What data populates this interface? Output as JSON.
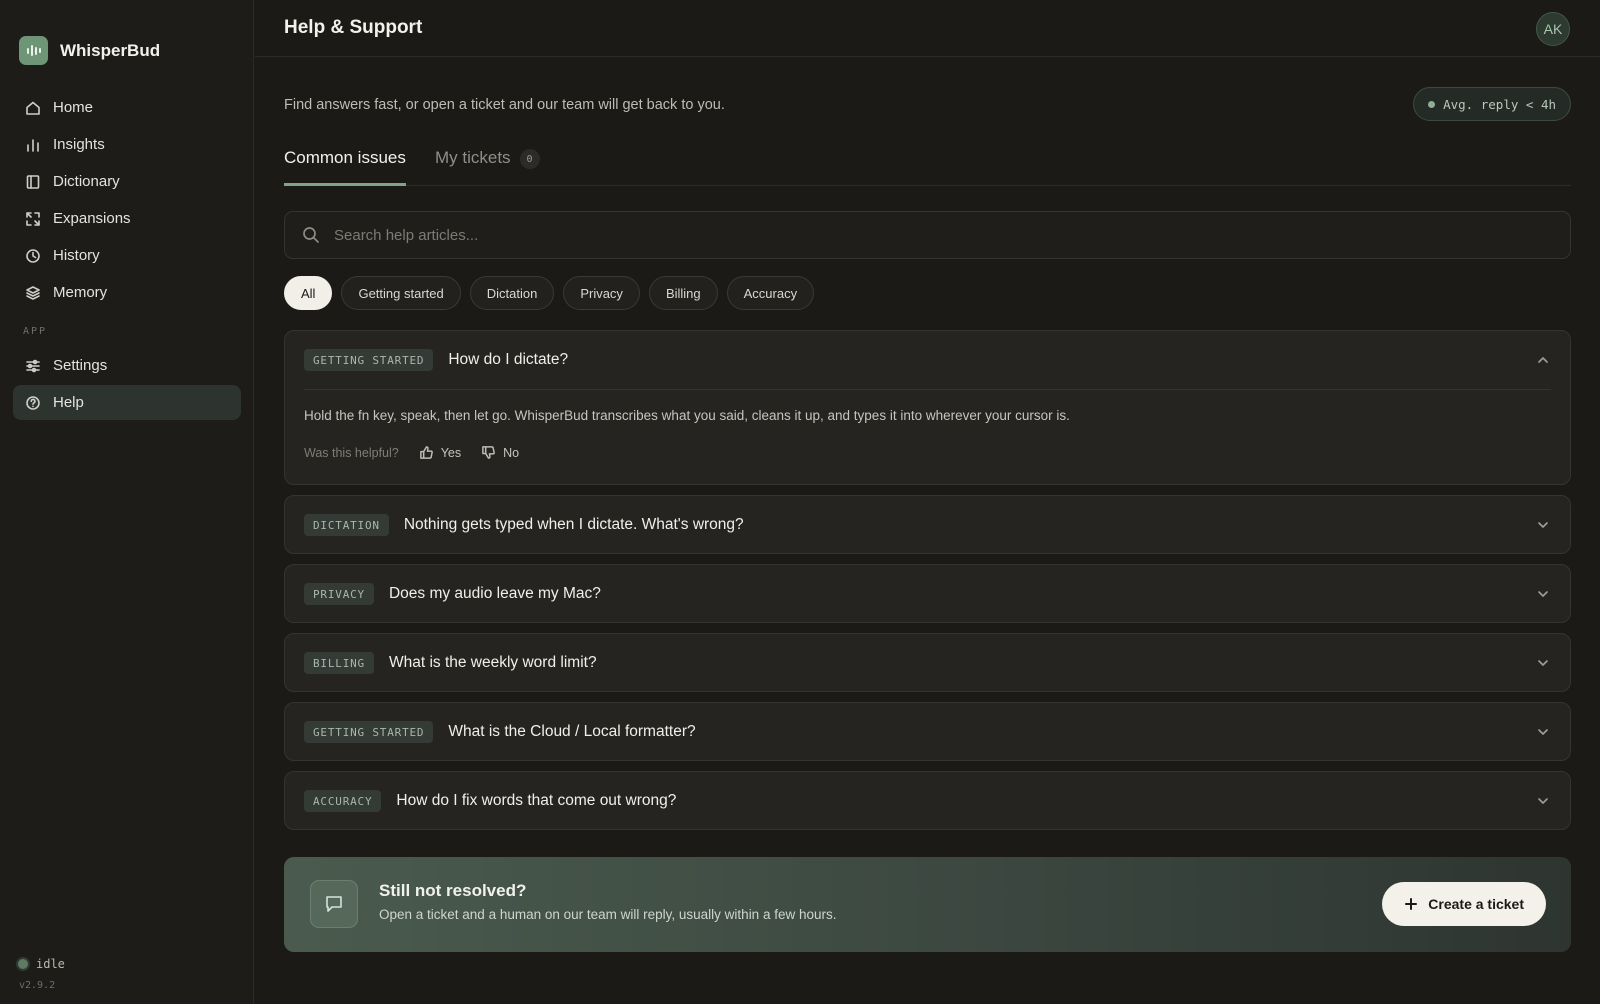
{
  "app": {
    "name": "WhisperBud",
    "version": "v2.9.2",
    "status": "idle"
  },
  "sidebar": {
    "items": [
      {
        "label": "Home",
        "icon": "home-icon"
      },
      {
        "label": "Insights",
        "icon": "bar-chart-icon"
      },
      {
        "label": "Dictionary",
        "icon": "book-icon"
      },
      {
        "label": "Expansions",
        "icon": "expand-icon"
      },
      {
        "label": "History",
        "icon": "clock-icon"
      },
      {
        "label": "Memory",
        "icon": "layers-icon"
      }
    ],
    "section_label": "APP",
    "app_items": [
      {
        "label": "Settings",
        "icon": "sliders-icon"
      },
      {
        "label": "Help",
        "icon": "help-circle-icon",
        "active": true
      }
    ]
  },
  "header": {
    "title": "Help & Support",
    "avatar_initials": "AK"
  },
  "main": {
    "intro": "Find answers fast, or open a ticket and our team will get back to you.",
    "reply_badge": "Avg. reply < 4h",
    "tabs": [
      {
        "label": "Common issues",
        "active": true
      },
      {
        "label": "My tickets",
        "count": "0"
      }
    ],
    "search": {
      "placeholder": "Search help articles...",
      "value": ""
    },
    "chips": [
      "All",
      "Getting started",
      "Dictation",
      "Privacy",
      "Billing",
      "Accuracy"
    ],
    "active_chip": "All",
    "faqs": [
      {
        "tag": "GETTING STARTED",
        "question": "How do I dictate?",
        "expanded": true,
        "answer": "Hold the fn key, speak, then let go. WhisperBud transcribes what you said, cleans it up, and types it into wherever your cursor is.",
        "helpful_label": "Was this helpful?",
        "yes_label": "Yes",
        "no_label": "No"
      },
      {
        "tag": "DICTATION",
        "question": "Nothing gets typed when I dictate. What's wrong?"
      },
      {
        "tag": "PRIVACY",
        "question": "Does my audio leave my Mac?"
      },
      {
        "tag": "BILLING",
        "question": "What is the weekly word limit?"
      },
      {
        "tag": "GETTING STARTED",
        "question": "What is the Cloud / Local formatter?"
      },
      {
        "tag": "ACCURACY",
        "question": "How do I fix words that come out wrong?"
      }
    ],
    "cta": {
      "title": "Still not resolved?",
      "subtitle": "Open a ticket and a human on our team will reply, usually within a few hours.",
      "button": "Create a ticket"
    }
  },
  "colors": {
    "accent": "#7fa488",
    "background": "#1b1a17",
    "brand": "#6e9676"
  }
}
